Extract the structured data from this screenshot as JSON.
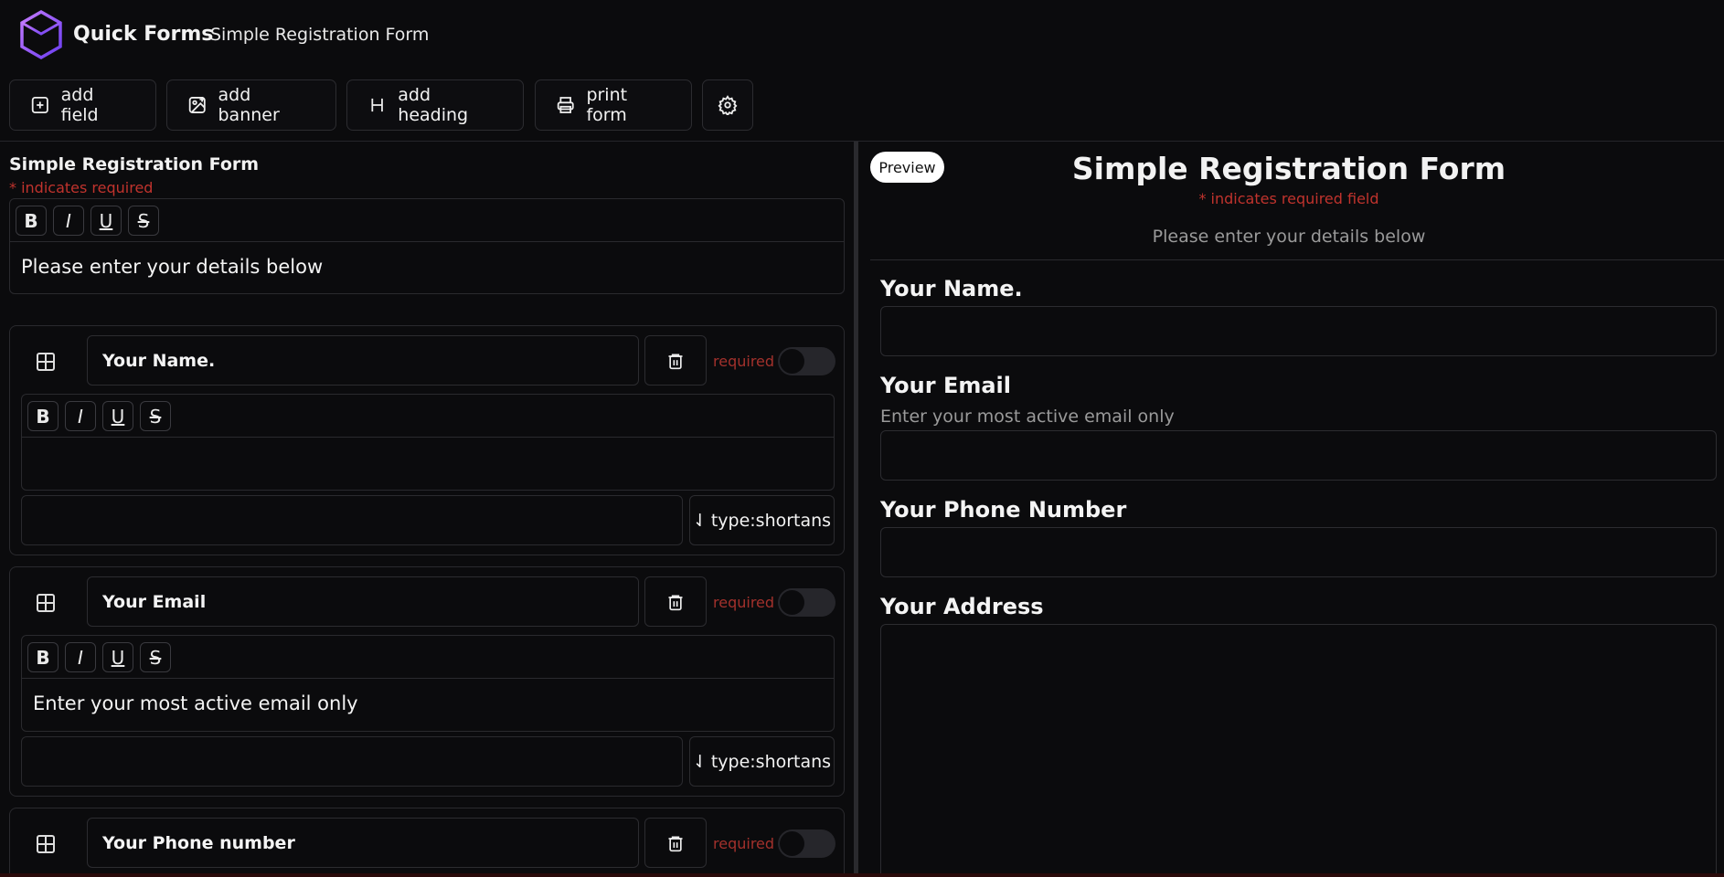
{
  "app": {
    "brand": "Quick Forms",
    "form_name": "Simple Registration Form"
  },
  "toolbar": {
    "add_field": "add field",
    "add_banner": "add banner",
    "add_heading": "add heading",
    "print_form": "print form"
  },
  "editor": {
    "title": "Simple Registration Form",
    "required_note": "* indicates required",
    "description": "Please enter your details below",
    "fields": [
      {
        "label": "Your Name.",
        "description": "",
        "required_label": "required",
        "type_label": "type:shortans"
      },
      {
        "label": "Your Email",
        "description": "Enter your most active email only",
        "required_label": "required",
        "type_label": "type:shortans"
      },
      {
        "label": "Your Phone number",
        "required_label": "required"
      }
    ],
    "format_buttons": [
      "B",
      "I",
      "U",
      "S"
    ]
  },
  "preview": {
    "badge": "Preview",
    "title": "Simple Registration Form",
    "required_note": "* indicates required field",
    "description": "Please enter your details below",
    "fields": [
      {
        "label": "Your Name."
      },
      {
        "label": "Your Email",
        "help": "Enter your most active email only"
      },
      {
        "label": "Your Phone Number"
      },
      {
        "label": "Your Address"
      }
    ]
  },
  "colors": {
    "background": "#0b0b0d",
    "accent": "#9b59f6",
    "required": "#c0332d"
  },
  "icons": [
    "cube-logo-icon",
    "plus-square-icon",
    "image-plus-icon",
    "heading-icon",
    "printer-icon",
    "gear-icon",
    "grid-icon",
    "trash-icon",
    "sort-icon"
  ]
}
